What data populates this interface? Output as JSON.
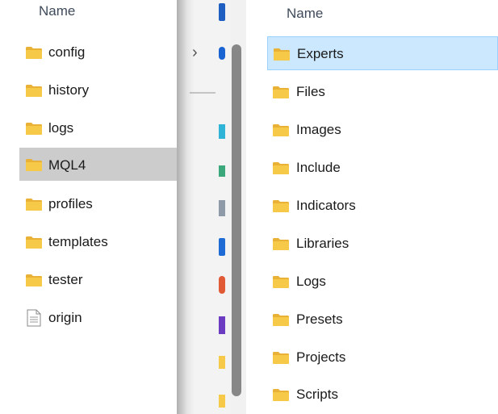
{
  "left_pane": {
    "column_header": "Name",
    "items": [
      {
        "label": "config",
        "type": "folder",
        "icon": "folder-icon"
      },
      {
        "label": "history",
        "type": "folder",
        "icon": "folder-icon"
      },
      {
        "label": "logs",
        "type": "folder",
        "icon": "folder-icon"
      },
      {
        "label": "MQL4",
        "type": "folder",
        "icon": "folder-icon",
        "selected": true
      },
      {
        "label": "profiles",
        "type": "folder",
        "icon": "folder-icon"
      },
      {
        "label": "templates",
        "type": "folder",
        "icon": "folder-icon"
      },
      {
        "label": "tester",
        "type": "folder",
        "icon": "folder-icon"
      },
      {
        "label": "origin",
        "type": "file",
        "icon": "file-icon"
      }
    ]
  },
  "nav_pane": {
    "expand_glyph": "›"
  },
  "right_pane": {
    "column_header": "Name",
    "items": [
      {
        "label": "Experts",
        "type": "folder",
        "icon": "folder-icon",
        "selected": true
      },
      {
        "label": "Files",
        "type": "folder",
        "icon": "folder-icon"
      },
      {
        "label": "Images",
        "type": "folder",
        "icon": "folder-icon"
      },
      {
        "label": "Include",
        "type": "folder",
        "icon": "folder-icon"
      },
      {
        "label": "Indicators",
        "type": "folder",
        "icon": "folder-icon"
      },
      {
        "label": "Libraries",
        "type": "folder",
        "icon": "folder-icon"
      },
      {
        "label": "Logs",
        "type": "folder",
        "icon": "folder-icon"
      },
      {
        "label": "Presets",
        "type": "folder",
        "icon": "folder-icon"
      },
      {
        "label": "Projects",
        "type": "folder",
        "icon": "folder-icon"
      },
      {
        "label": "Scripts",
        "type": "folder",
        "icon": "folder-icon"
      }
    ]
  },
  "colors": {
    "folder": "#f7c948",
    "left_selection": "#cccccc",
    "right_selection": "#cce8ff",
    "right_selection_border": "#99d1ff"
  }
}
